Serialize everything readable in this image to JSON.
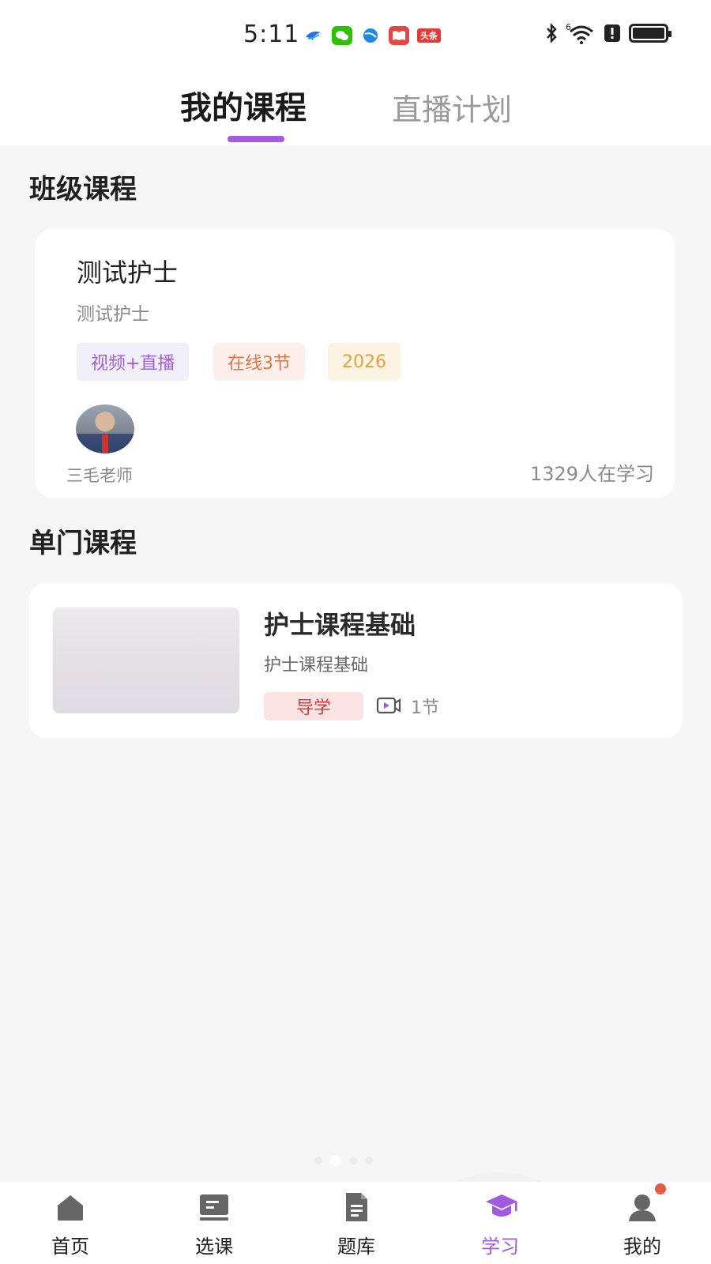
{
  "status_bar": {
    "time": "5:11",
    "app_icons": [
      {
        "name": "bird-app-icon",
        "color": "#2a6fdb"
      },
      {
        "name": "wechat-icon",
        "color": "#2dc100"
      },
      {
        "name": "browser-icon",
        "color": "#1e88e5"
      },
      {
        "name": "reader-icon",
        "color": "#e64545"
      },
      {
        "name": "toutiao-icon",
        "color": "#e53935",
        "text": "头条"
      }
    ],
    "signal_label": "6"
  },
  "header": {
    "tabs": [
      {
        "label": "我的课程",
        "active": true
      },
      {
        "label": "直播计划",
        "active": false
      }
    ],
    "accent_color": "#a25ae0"
  },
  "sections": {
    "class_course_title": "班级课程",
    "single_course_title": "单门课程"
  },
  "class_course": {
    "title": "测试护士",
    "subtitle": "测试护士",
    "tags": [
      "视频+直播",
      "在线3节",
      "2026"
    ],
    "teacher_name": "三毛老师",
    "learners": "1329人在学习"
  },
  "single_course": {
    "title": "护士课程基础",
    "subtitle": "护士课程基础",
    "tag": "导学",
    "lessons": "1节"
  },
  "bottom_nav": {
    "items": [
      {
        "label": "首页",
        "icon": "home-icon"
      },
      {
        "label": "选课",
        "icon": "course-select-icon"
      },
      {
        "label": "题库",
        "icon": "question-bank-icon"
      },
      {
        "label": "学习",
        "icon": "graduation-cap-icon",
        "active": true
      },
      {
        "label": "我的",
        "icon": "profile-icon",
        "badge": true
      }
    ]
  }
}
